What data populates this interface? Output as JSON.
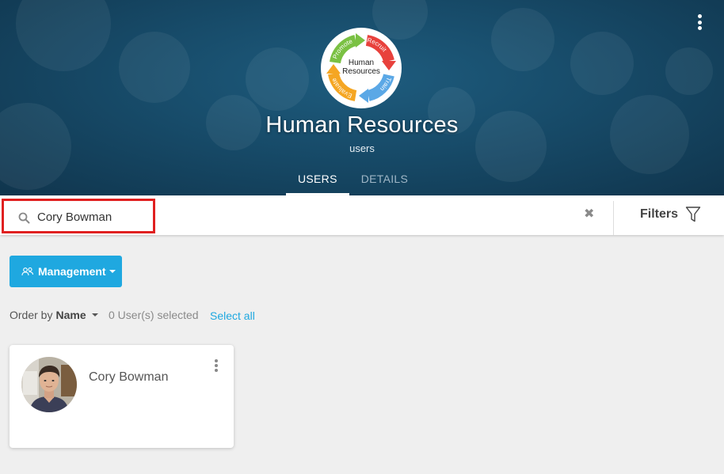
{
  "header": {
    "title": "Human Resources",
    "subtitle": "users",
    "logo": {
      "center_line1": "Human",
      "center_line2": "Resources",
      "arc_labels": [
        "Promote",
        "Recruit",
        "Train",
        "Evaluate"
      ],
      "arc_colors": [
        "#7ac143",
        "#e8413c",
        "#5ba8e6",
        "#f5a623"
      ]
    },
    "tabs": [
      {
        "label": "USERS",
        "active": true
      },
      {
        "label": "DETAILS",
        "active": false
      }
    ],
    "menu_icon": "vertical-dots-icon",
    "background_color": "#174b69"
  },
  "search": {
    "value": "Cory Bowman",
    "placeholder": "",
    "clear_icon": "✖",
    "filters_label": "Filters",
    "highlight_color": "#e02020"
  },
  "toolbar": {
    "management_label": "Management",
    "order_by_label": "Order by",
    "order_by_value": "Name",
    "selected_count": "0 User(s) selected",
    "select_all_label": "Select all",
    "accent_color": "#1fa8e0"
  },
  "users": [
    {
      "name": "Cory Bowman",
      "avatar": "user-photo"
    }
  ]
}
